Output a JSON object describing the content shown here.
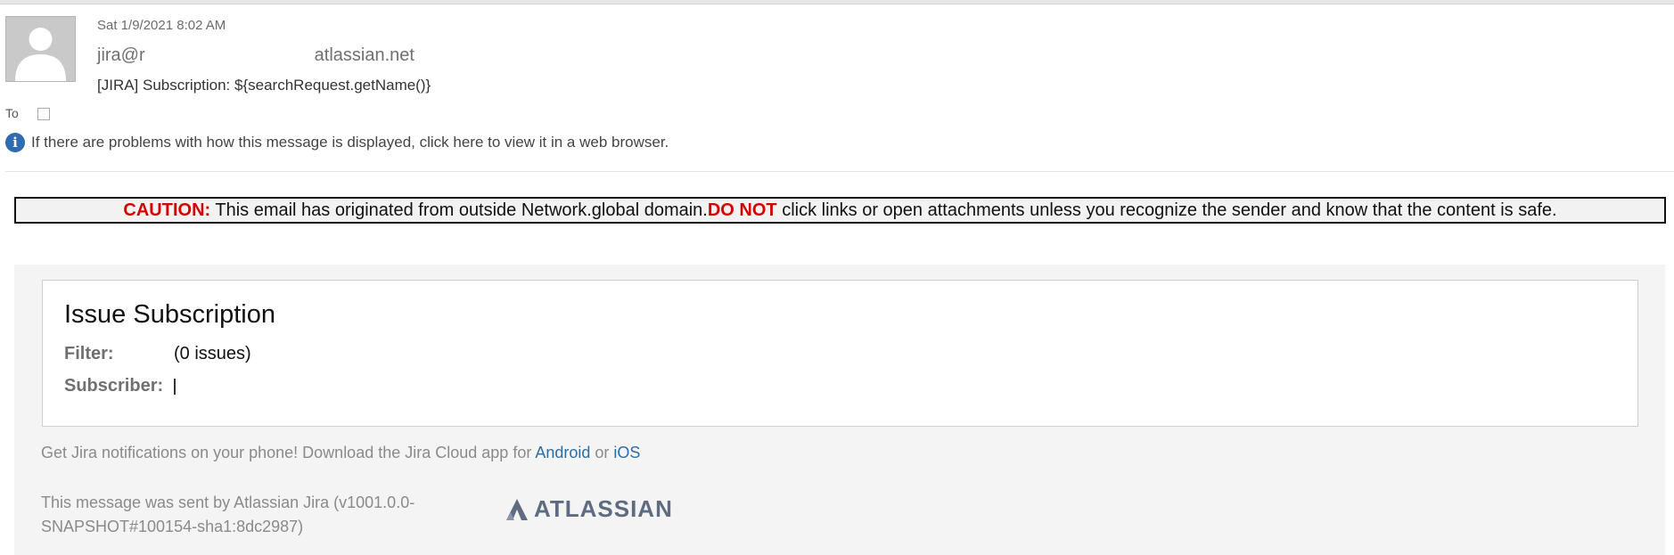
{
  "email_header": {
    "date": "Sat 1/9/2021 8:02 AM",
    "from_prefix": "jira@r",
    "from_suffix": "atlassian.net",
    "subject": "[JIRA] Subscription: ${searchRequest.getName()}",
    "to_label": "To"
  },
  "info_bar": {
    "text": "If there are problems with how this message is displayed, click here to view it in a web browser."
  },
  "caution_banner": {
    "caution_label": "CAUTION:",
    "text_1": " This email has originated from outside Network.global domain.",
    "do_not_label": "DO NOT",
    "text_2": " click links or open attachments unless you recognize the sender and know that the content is safe."
  },
  "subscription_card": {
    "title": "Issue Subscription",
    "filter_label": "Filter:",
    "filter_value": "(0 issues)",
    "subscriber_label": "Subscriber:"
  },
  "footer": {
    "notify_text": "Get Jira notifications on your phone! Download the Jira Cloud app for ",
    "android_link": "Android",
    "or_text": " or ",
    "ios_link": "iOS",
    "sent_by": "This message was sent by Atlassian Jira (v1001.0.0-SNAPSHOT#100154-sha1:8dc2987)",
    "logo_text": "ATLASSIAN"
  },
  "colors": {
    "caution_red": "#d40000",
    "link_blue": "#2e6da4",
    "info_blue": "#2f6bb1",
    "atlassian_logo": "#5e6b80"
  },
  "icons": {
    "avatar": "default-person-avatar-icon",
    "info": "info-circle-icon",
    "logo": "atlassian-logo-icon"
  }
}
